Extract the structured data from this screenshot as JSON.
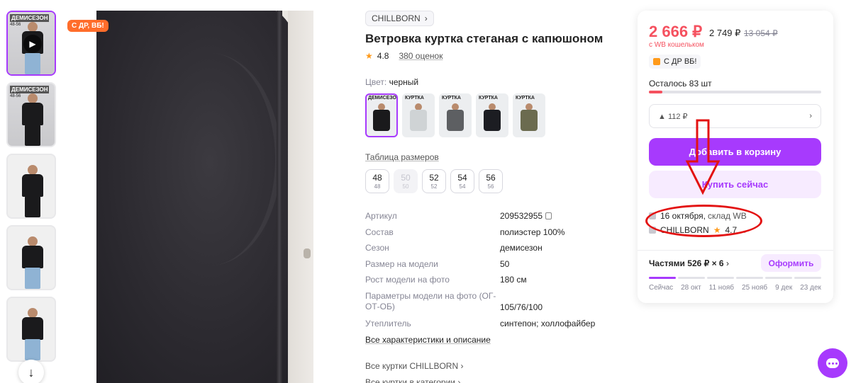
{
  "promo_badge": "С ДР, ВБ!",
  "thumbs": [
    {
      "tag": "ДЕМИСЕЗОН",
      "sub": "48-56"
    },
    {
      "tag": "ДЕМИСЕЗОН",
      "sub": "48-56"
    },
    {
      "tag": "",
      "sub": ""
    },
    {
      "tag": "",
      "sub": ""
    },
    {
      "tag": "",
      "sub": ""
    }
  ],
  "product": {
    "brand": "CHILLBORN",
    "title": "Ветровка куртка стеганая с капюшоном",
    "rating": "4.8",
    "reviews": "380 оценок",
    "color_label": "Цвет:",
    "color_value": "черный",
    "color_swatches": [
      {
        "tag": "ДЕМИСЕЗОН",
        "color": "#1a1a1c"
      },
      {
        "tag": "КУРТКА",
        "color": "#cfd3d5"
      },
      {
        "tag": "КУРТКА",
        "color": "#5d5f62"
      },
      {
        "tag": "КУРТКА",
        "color": "#1c1d22"
      },
      {
        "tag": "КУРТКА",
        "color": "#6b6b4f"
      }
    ],
    "size_table": "Таблица размеров",
    "sizes": [
      {
        "n": "48",
        "r": "48",
        "disabled": false
      },
      {
        "n": "50",
        "r": "50",
        "disabled": true
      },
      {
        "n": "52",
        "r": "52",
        "disabled": false
      },
      {
        "n": "54",
        "r": "54",
        "disabled": false
      },
      {
        "n": "56",
        "r": "56",
        "disabled": false
      }
    ],
    "specs": [
      {
        "k": "Артикул",
        "v": "209532955"
      },
      {
        "k": "Состав",
        "v": "полиэстер 100%"
      },
      {
        "k": "Сезон",
        "v": "демисезон"
      },
      {
        "k": "Размер на модели",
        "v": "50"
      },
      {
        "k": "Рост модели на фото",
        "v": "180 см"
      },
      {
        "k": "Параметры модели на фото (ОГ-ОТ-ОБ)",
        "v": "105/76/100"
      },
      {
        "k": "Утеплитель",
        "v": "синтепон; холлофайбер"
      }
    ],
    "all_specs": "Все характеристики и описание",
    "all_brand": "Все куртки CHILLBORN",
    "all_cat": "Все куртки в категории"
  },
  "panel": {
    "price": "2 666 ₽",
    "price_alt": "2 749 ₽",
    "price_old": "13 054 ₽",
    "wallet": "с WB кошельком",
    "dr_chip": "С ДР ВБ!",
    "stock": "Осталось 83 шт",
    "stock_fraction": 0.08,
    "points": "112 ₽",
    "add_to_cart": "Добавить в корзину",
    "buy_now": "Купить сейчас",
    "delivery_date": "16 октября,",
    "delivery_wh": "склад WB",
    "seller": "CHILLBORN",
    "seller_rating": "4.7",
    "installments_label": "Частями",
    "installments_value": "526 ₽ × 6",
    "form_btn": "Оформить",
    "dates": [
      "Сейчас",
      "28 окт",
      "11 нояб",
      "25 нояб",
      "9 дек",
      "23 дек"
    ]
  },
  "colors": {
    "accent": "#a73afd",
    "price": "#f5515f",
    "annotation": "#e31212"
  }
}
